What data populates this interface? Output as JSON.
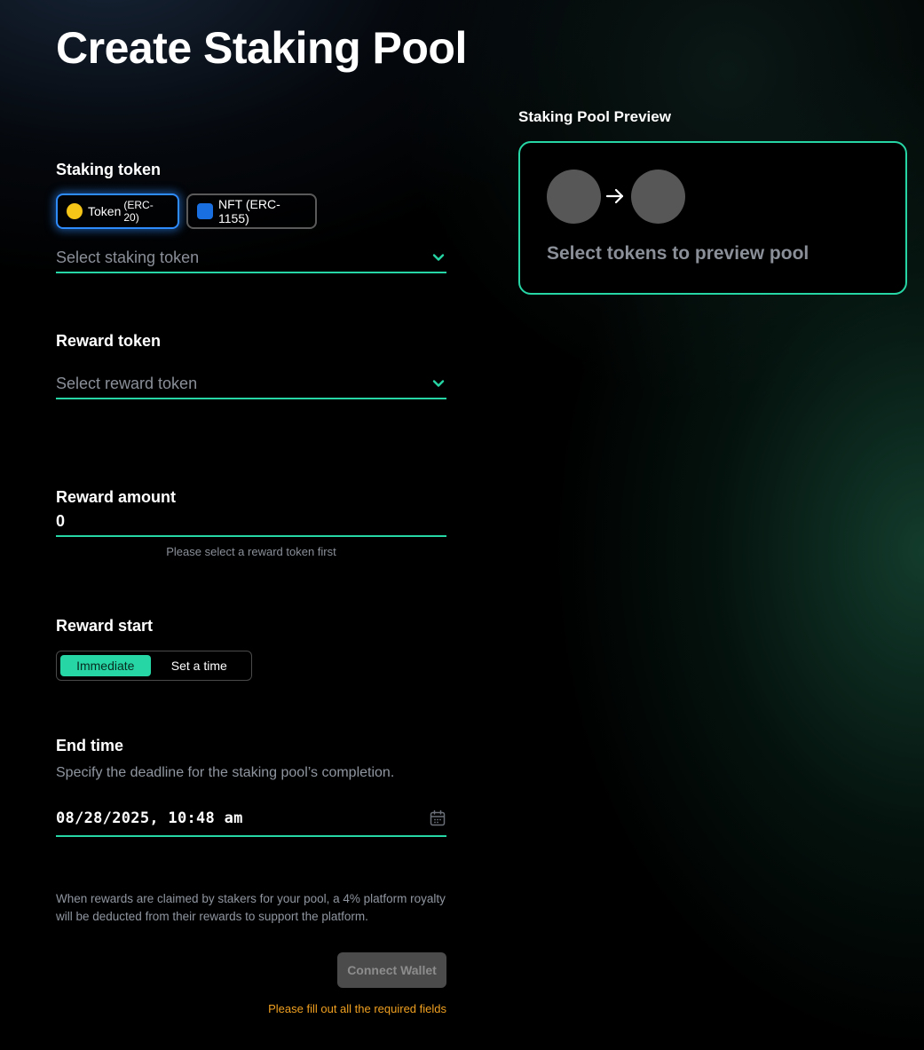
{
  "page": {
    "title": "Create Staking Pool"
  },
  "staking_token": {
    "label": "Staking token",
    "type_options": [
      {
        "label": "Token",
        "sub": "(ERC-20)",
        "color": "#f5c518",
        "active": true
      },
      {
        "label": "NFT (ERC-1155)",
        "sub": "",
        "color": "#1a6fe0",
        "active": false
      }
    ],
    "select_placeholder": "Select staking token"
  },
  "reward_token": {
    "label": "Reward token",
    "select_placeholder": "Select reward token"
  },
  "reward_amount": {
    "label": "Reward amount",
    "value": "0",
    "helper": "Please select a reward token first"
  },
  "reward_start": {
    "label": "Reward start",
    "options": [
      "Immediate",
      "Set a time"
    ],
    "selected": "Immediate"
  },
  "end_time": {
    "label": "End time",
    "description": "Specify the deadline for the staking pool’s completion.",
    "value": "08/28/2025, 10:48 am"
  },
  "footnote": "When rewards are claimed by stakers for your pool, a 4% platform royalty will be deducted from their rewards to support the platform.",
  "actions": {
    "connect_wallet": "Connect Wallet",
    "error": "Please fill out all the required fields"
  },
  "preview": {
    "label": "Staking Pool Preview",
    "placeholder": "Select tokens to preview pool"
  },
  "colors": {
    "accent": "#27d6a5",
    "active_border": "#2f8cff",
    "error": "#f0a020",
    "token_dot": "#f5c518",
    "nft_square": "#1a6fe0"
  }
}
